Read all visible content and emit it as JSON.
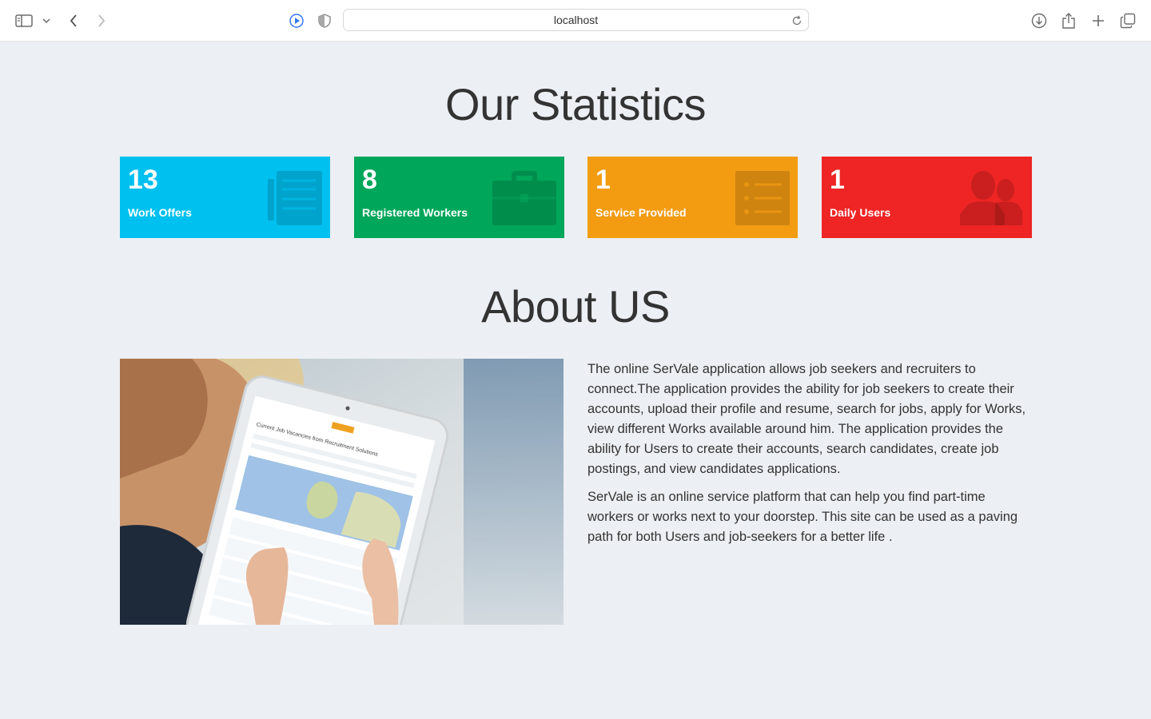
{
  "browser": {
    "url": "localhost"
  },
  "stats": {
    "title": "Our Statistics",
    "cards": [
      {
        "value": "13",
        "label": "Work Offers",
        "color": "#00c0ef",
        "icon": "newspaper-icon"
      },
      {
        "value": "8",
        "label": "Registered Workers",
        "color": "#00a65a",
        "icon": "briefcase-icon"
      },
      {
        "value": "1",
        "label": "Service Provided",
        "color": "#f39c12",
        "icon": "list-icon"
      },
      {
        "value": "1",
        "label": "Daily Users",
        "color": "#ee2524",
        "icon": "users-icon"
      }
    ]
  },
  "about": {
    "title": "About US",
    "paragraphs": [
      "The online SerVale application allows job seekers and recruiters to connect.The application provides the ability for job seekers to create their accounts, upload their profile and resume, search for jobs, apply for Works, view different Works available around him. The application provides the ability for Users to create their accounts, search candidates, create job postings, and view candidates applications.",
      "SerVale is an online service platform that can help you find part-time workers or works next to your doorstep. This site can be used as a paving path for both Users and job-seekers for a better life ."
    ],
    "image": {
      "tablet_heading": "Current Job Vacancies from Recruitment Solutions"
    }
  }
}
